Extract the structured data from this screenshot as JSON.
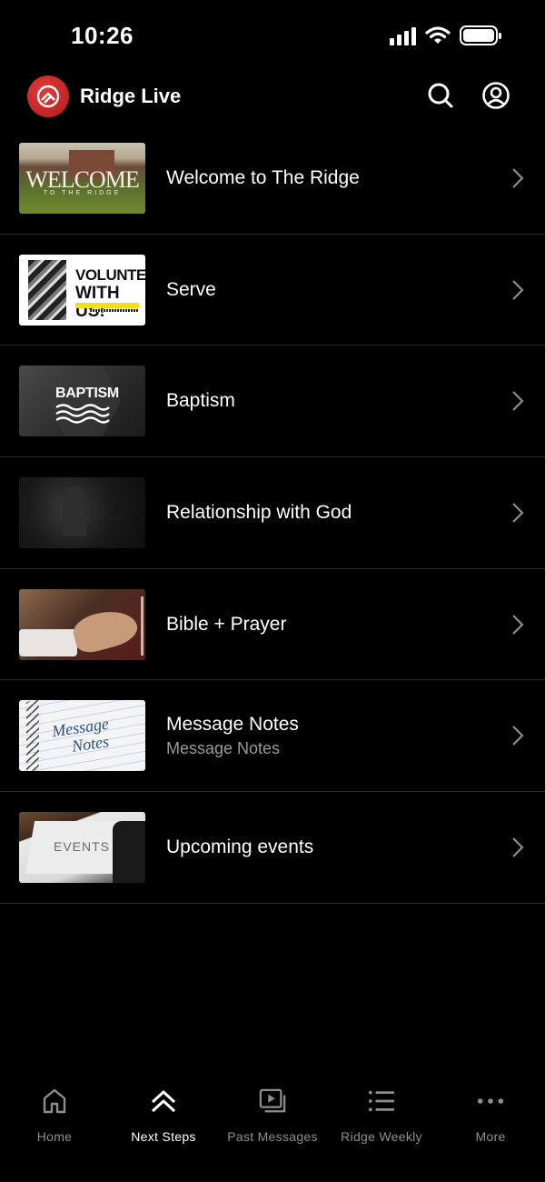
{
  "status_bar": {
    "time": "10:26"
  },
  "header": {
    "title": "Ridge Live"
  },
  "list": {
    "items": [
      {
        "title": "Welcome to The Ridge",
        "subtitle": "",
        "thumb": {
          "main": "WELCOME",
          "sub": "TO THE RIDGE"
        }
      },
      {
        "title": "Serve",
        "subtitle": "",
        "thumb": {
          "line1": "VOLUNTEER",
          "line2": "WITH US!"
        }
      },
      {
        "title": "Baptism",
        "subtitle": "",
        "thumb": {
          "main": "BAPTISM"
        }
      },
      {
        "title": "Relationship with God",
        "subtitle": ""
      },
      {
        "title": "Bible + Prayer",
        "subtitle": ""
      },
      {
        "title": "Message Notes",
        "subtitle": "Message Notes",
        "thumb": {
          "line1": "Message",
          "line2": "Notes"
        }
      },
      {
        "title": "Upcoming events",
        "subtitle": "",
        "thumb": {
          "main": "EVENTS"
        }
      }
    ]
  },
  "tabs": [
    {
      "label": "Home",
      "icon": "home-icon",
      "active": false
    },
    {
      "label": "Next Steps",
      "icon": "chevrons-up-icon",
      "active": true
    },
    {
      "label": "Past Messages",
      "icon": "video-library-icon",
      "active": false
    },
    {
      "label": "Ridge Weekly",
      "icon": "list-icon",
      "active": false
    },
    {
      "label": "More",
      "icon": "more-dots-icon",
      "active": false
    }
  ],
  "colors": {
    "background": "#000000",
    "brand": "#d22a2a",
    "divider": "#2b2b2b",
    "inactive": "#8e8e8e"
  }
}
